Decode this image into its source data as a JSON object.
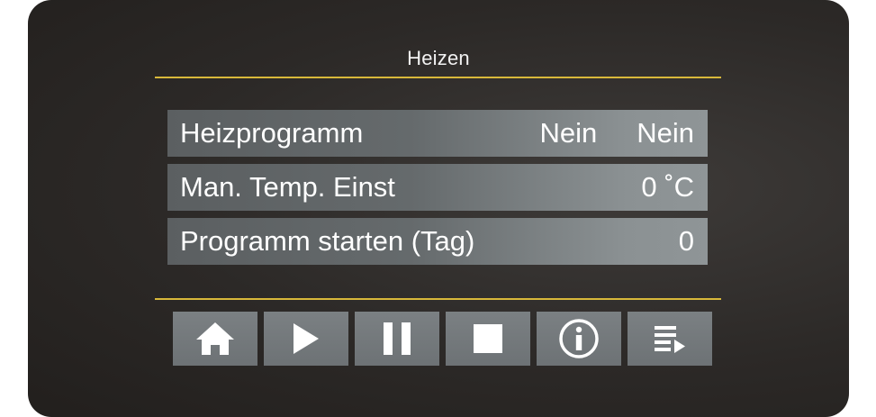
{
  "screen": {
    "title": "Heizen"
  },
  "rows": [
    {
      "label": "Heizprogramm",
      "value1": "Nein",
      "value2": "Nein"
    },
    {
      "label": "Man. Temp. Einst",
      "value": "0 ˚C"
    },
    {
      "label": "Programm starten (Tag)",
      "value": "0"
    }
  ],
  "toolbar": {
    "buttons": [
      {
        "icon": "home-icon"
      },
      {
        "icon": "play-icon"
      },
      {
        "icon": "pause-icon"
      },
      {
        "icon": "stop-icon"
      },
      {
        "icon": "info-icon"
      },
      {
        "icon": "list-icon"
      }
    ]
  },
  "colors": {
    "accent": "#d8b83a",
    "background": "#2c2927",
    "row": "#656a6c",
    "button": "#74797c",
    "text": "#ffffff"
  }
}
